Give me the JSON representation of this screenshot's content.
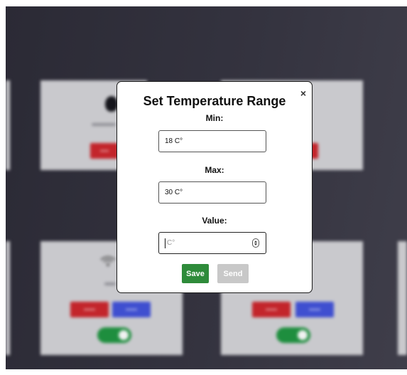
{
  "modal": {
    "title": "Set Temperature Range",
    "close_label": "×",
    "min_label": "Min:",
    "min_value": "18 C°",
    "max_label": "Max:",
    "max_value": "30 C°",
    "value_label": "Value:",
    "value_placeholder": "C°",
    "save_label": "Save",
    "send_label": "Send"
  },
  "colors": {
    "save_button": "#2e8b3a",
    "send_button_disabled": "#c8c8c8",
    "overlay": "#2b2a35",
    "card_red_button": "#c3252b",
    "card_blue_button": "#3f4fd0",
    "toggle_on": "#1e8e3e"
  },
  "icons": {
    "close": "close-icon",
    "spinner": "number-spinner-icon",
    "device": "water-drop-icon",
    "wifi": "wifi-icon"
  }
}
